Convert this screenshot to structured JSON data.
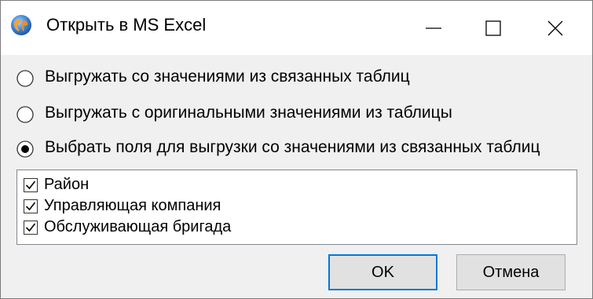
{
  "window": {
    "title": "Открыть в MS Excel",
    "icon": "globe-icon"
  },
  "caption_buttons": {
    "minimize_icon": "minimize-icon",
    "maximize_icon": "maximize-icon",
    "close_icon": "close-icon"
  },
  "export_options": [
    {
      "label": "Выгружать со значениями из связанных таблиц",
      "selected": false
    },
    {
      "label": "Выгружать с оригинальными значениями из таблицы",
      "selected": false
    },
    {
      "label": "Выбрать поля для выгрузки со значениями из связанных таблиц",
      "selected": true
    }
  ],
  "fields": [
    {
      "label": "Район",
      "checked": true
    },
    {
      "label": "Управляющая компания",
      "checked": true
    },
    {
      "label": "Обслуживающая бригада",
      "checked": true
    }
  ],
  "buttons": {
    "ok_label": "OK",
    "cancel_label": "Отмена"
  },
  "colors": {
    "focus_border": "#0078d7",
    "dialog_bg": "#f0f0f0",
    "titlebar_bg": "#ffffff"
  }
}
